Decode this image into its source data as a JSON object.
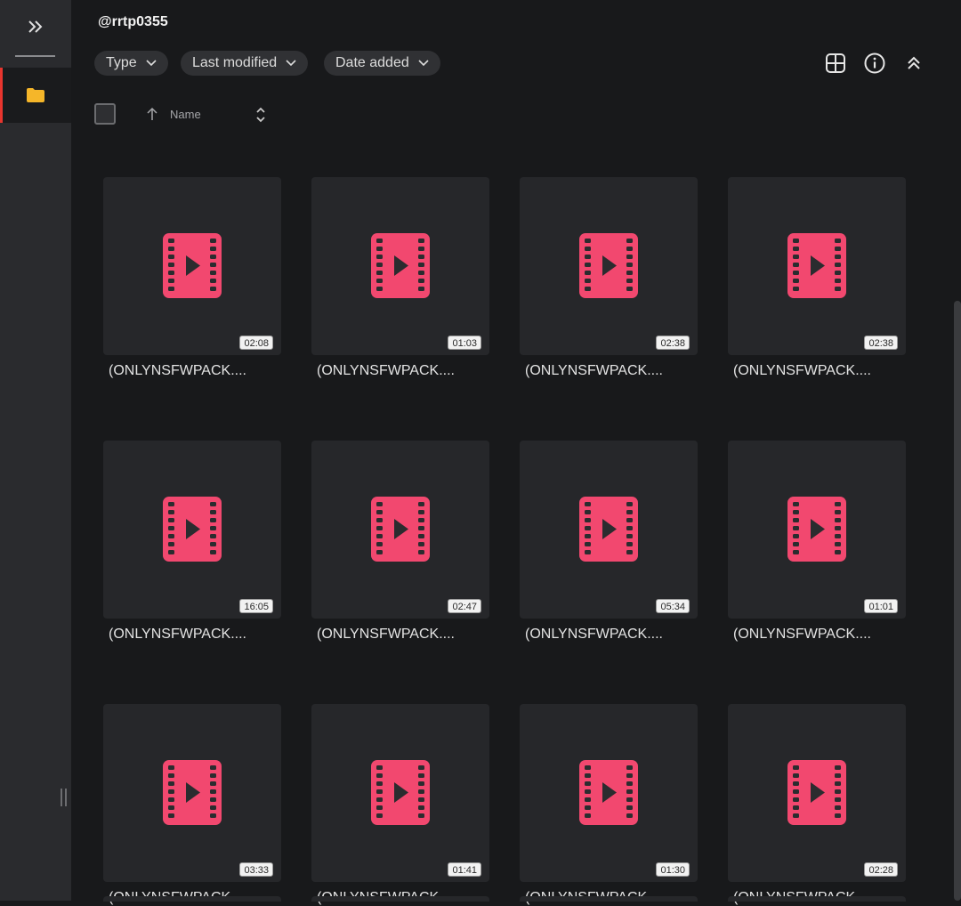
{
  "sidebar": {
    "expand_icon": "double-chevron-right-icon",
    "folder_icon": "folder-icon",
    "folder_color": "#f5b629",
    "active_indicator_color": "#e8352e"
  },
  "header": {
    "title": "@rrtp0355"
  },
  "filters": [
    {
      "label": "Type"
    },
    {
      "label": "Last modified"
    },
    {
      "label": "Date added"
    }
  ],
  "toolbar": {
    "icons": [
      "grid-view-icon",
      "info-icon",
      "collapse-up-icon"
    ]
  },
  "list_header": {
    "name_label": "Name"
  },
  "accent_color": "#f2486f",
  "files": [
    {
      "name": "(ONLYNSFWPACK....",
      "duration": "02:08"
    },
    {
      "name": "(ONLYNSFWPACK....",
      "duration": "01:03"
    },
    {
      "name": "(ONLYNSFWPACK....",
      "duration": "02:38"
    },
    {
      "name": "(ONLYNSFWPACK....",
      "duration": "02:38"
    },
    {
      "name": "(ONLYNSFWPACK....",
      "duration": "16:05"
    },
    {
      "name": "(ONLYNSFWPACK....",
      "duration": "02:47"
    },
    {
      "name": "(ONLYNSFWPACK....",
      "duration": "05:34"
    },
    {
      "name": "(ONLYNSFWPACK....",
      "duration": "01:01"
    },
    {
      "name": "(ONLYNSFWPACK....",
      "duration": "03:33"
    },
    {
      "name": "(ONLYNSFWPACK....",
      "duration": "01:41"
    },
    {
      "name": "(ONLYNSFWPACK....",
      "duration": "01:30"
    },
    {
      "name": "(ONLYNSFWPACK....",
      "duration": "02:28"
    }
  ]
}
